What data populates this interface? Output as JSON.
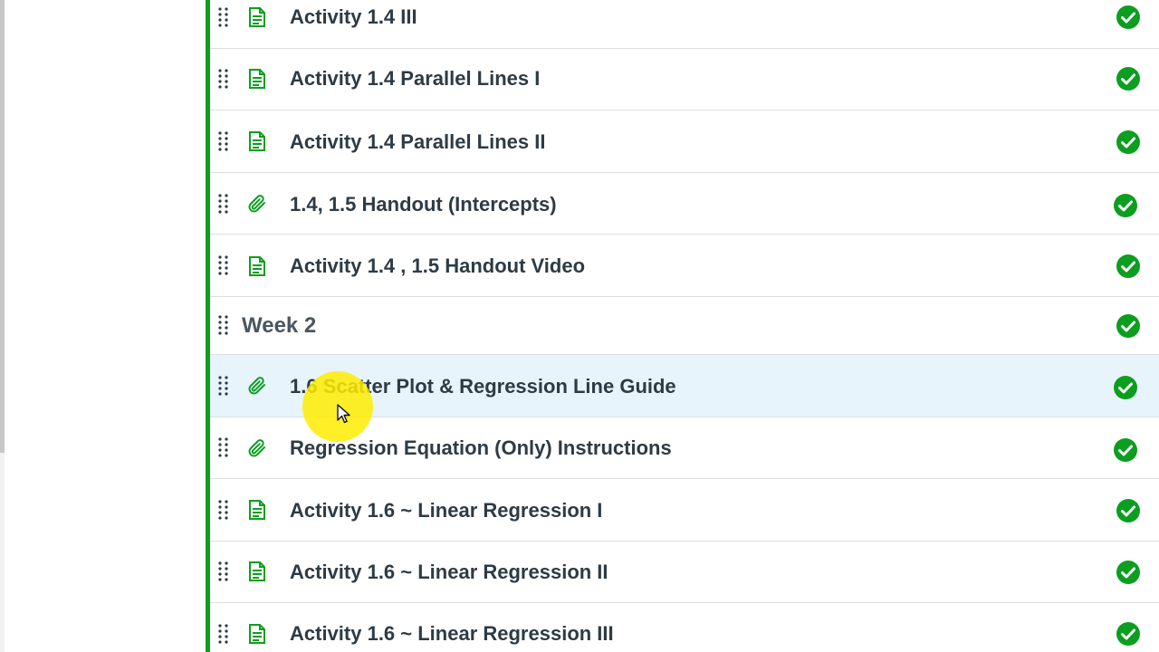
{
  "colors": {
    "accent_green": "#0b9e1f",
    "title_text": "#2d3b45",
    "header_text": "#4a565f",
    "row_divider": "#dcdfe2",
    "highlight_row": "#e8f4fb",
    "status_green": "#0b9e1f"
  },
  "module": {
    "items": [
      {
        "title": "Activity 1.4 III",
        "icon": "page-icon",
        "status": "completed-check-icon"
      },
      {
        "title": "Activity 1.4 Parallel Lines I",
        "icon": "page-icon",
        "status": "completed-check-icon"
      },
      {
        "title": "Activity 1.4 Parallel Lines II",
        "icon": "page-icon",
        "status": "completed-check-icon"
      },
      {
        "title": "1.4, 1.5 Handout (Intercepts)",
        "icon": "attachment-icon",
        "status": "completed-check-icon"
      },
      {
        "title": "Activity 1.4 , 1.5 Handout Video",
        "icon": "page-icon",
        "status": "completed-check-icon"
      },
      {
        "title": "Week 2",
        "icon": "",
        "status": "completed-check-icon"
      },
      {
        "title": "1.6 Scatter Plot & Regression Line Guide",
        "icon": "attachment-icon",
        "status": "completed-check-icon"
      },
      {
        "title": "Regression Equation (Only) Instructions",
        "icon": "attachment-icon",
        "status": "completed-check-icon"
      },
      {
        "title": "Activity 1.6 ~ Linear Regression I",
        "icon": "page-icon",
        "status": "completed-check-icon"
      },
      {
        "title": "Activity 1.6 ~ Linear Regression II",
        "icon": "page-icon",
        "status": "completed-check-icon"
      },
      {
        "title": "Activity 1.6 ~ Linear Regression III",
        "icon": "page-icon",
        "status": "completed-check-icon"
      }
    ]
  }
}
